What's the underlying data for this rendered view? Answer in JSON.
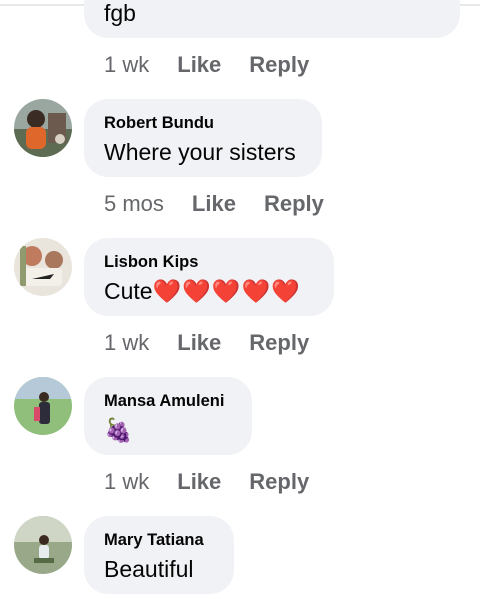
{
  "actions": {
    "like": "Like",
    "reply": "Reply"
  },
  "comments": [
    {
      "text": "fgb",
      "time": "1 wk"
    },
    {
      "author": "Robert Bundu",
      "text": "Where your sisters",
      "time": "5 mos"
    },
    {
      "author": "Lisbon Kips",
      "text": "Cute",
      "emoji": "❤️❤️❤️❤️❤️",
      "time": "1 wk"
    },
    {
      "author": "Mansa Amuleni",
      "text": "🍇",
      "time": "1 wk"
    },
    {
      "author": "Mary Tatiana",
      "text": "Beautiful"
    }
  ],
  "colors": {
    "bubble": "#f0f2f5",
    "meta_text": "#65676b",
    "heart": "#f02849"
  }
}
